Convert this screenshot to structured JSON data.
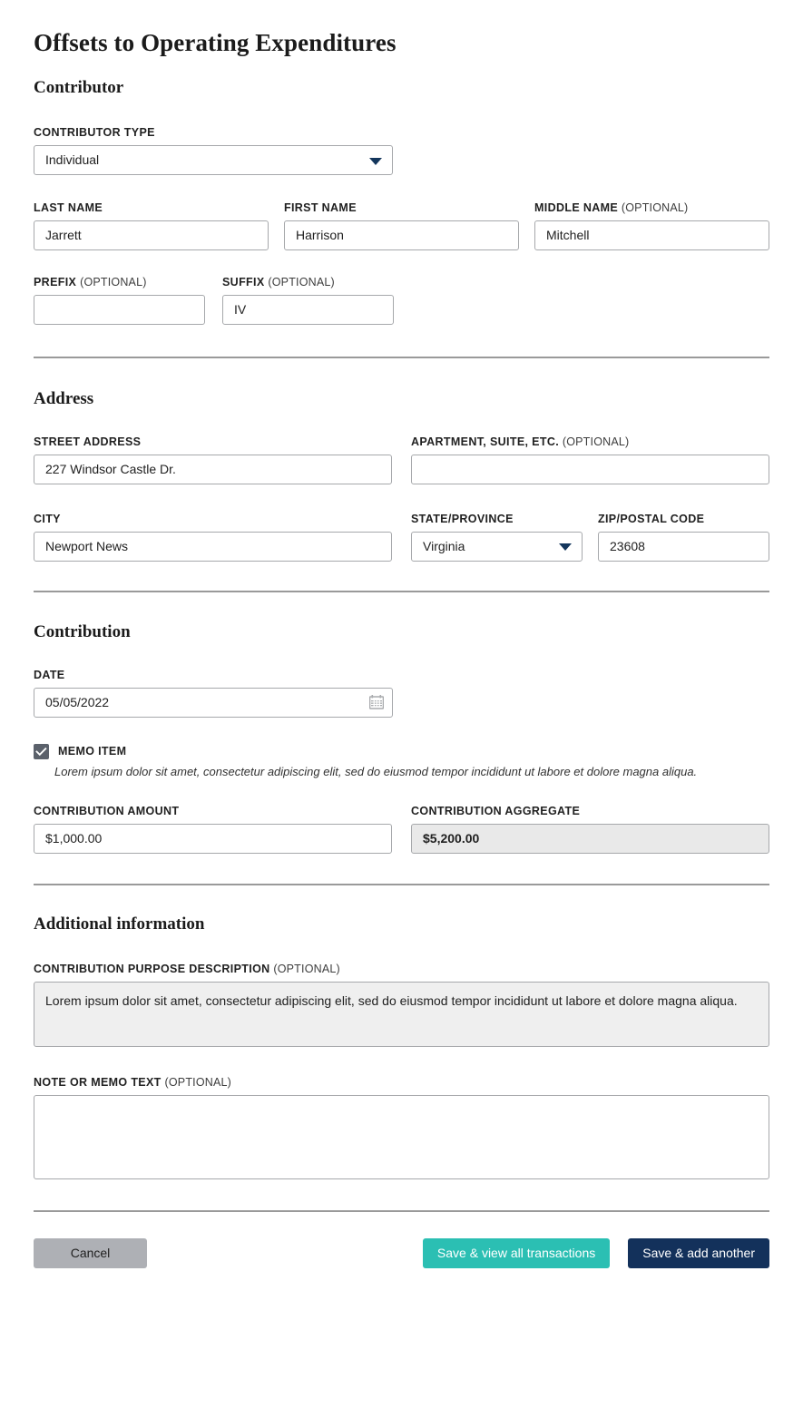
{
  "page": {
    "title": "Offsets to Operating Expenditures"
  },
  "sections": {
    "contributor": {
      "heading": "Contributor",
      "contributor_type": {
        "label": "CONTRIBUTOR TYPE",
        "value": "Individual",
        "caret_icon": "chevron-down-icon"
      },
      "last_name": {
        "label": "LAST NAME",
        "value": "Jarrett"
      },
      "first_name": {
        "label": "FIRST NAME",
        "value": "Harrison"
      },
      "middle_name": {
        "label": "MIDDLE NAME",
        "optional": "(OPTIONAL)",
        "value": "Mitchell"
      },
      "prefix": {
        "label": "PREFIX",
        "optional": "(OPTIONAL)",
        "value": ""
      },
      "suffix": {
        "label": "SUFFIX",
        "optional": "(OPTIONAL)",
        "value": "IV"
      }
    },
    "address": {
      "heading": "Address",
      "street": {
        "label": "STREET ADDRESS",
        "value": "227 Windsor Castle Dr."
      },
      "apartment": {
        "label": "APARTMENT, SUITE, ETC.",
        "optional": "(OPTIONAL)",
        "value": ""
      },
      "city": {
        "label": "CITY",
        "value": "Newport News"
      },
      "state": {
        "label": "STATE/PROVINCE",
        "value": "Virginia",
        "caret_icon": "chevron-down-icon"
      },
      "zip": {
        "label": "ZIP/POSTAL CODE",
        "value": "23608"
      }
    },
    "contribution": {
      "heading": "Contribution",
      "date": {
        "label": "DATE",
        "value": "05/05/2022",
        "icon": "calendar-icon"
      },
      "memo_item": {
        "label": "MEMO ITEM",
        "checked": true,
        "description": "Lorem ipsum dolor sit amet, consectetur adipiscing elit, sed do eiusmod tempor incididunt ut labore et dolore magna aliqua."
      },
      "amount": {
        "label": "CONTRIBUTION AMOUNT",
        "value": "$1,000.00"
      },
      "aggregate": {
        "label": "CONTRIBUTION AGGREGATE",
        "value": "$5,200.00",
        "disabled": true
      }
    },
    "additional": {
      "heading": "Additional information",
      "purpose": {
        "label": "CONTRIBUTION PURPOSE DESCRIPTION",
        "optional": "(OPTIONAL)",
        "value": "Lorem ipsum dolor sit amet, consectetur adipiscing elit, sed do eiusmod tempor incididunt ut labore et dolore magna aliqua."
      },
      "note": {
        "label": "NOTE OR MEMO TEXT",
        "optional": "(OPTIONAL)",
        "value": ""
      }
    }
  },
  "footer": {
    "cancel_label": "Cancel",
    "save_view_label": "Save & view all transactions",
    "save_add_label": "Save & add another"
  },
  "colors": {
    "teal": "#2bbfb3",
    "navy": "#13315b",
    "cancel_gray": "#aeb0b5",
    "checkbox_gray": "#5b616b",
    "border_gray": "#a6a8ab",
    "disabled_bg": "#e9e9e9"
  }
}
